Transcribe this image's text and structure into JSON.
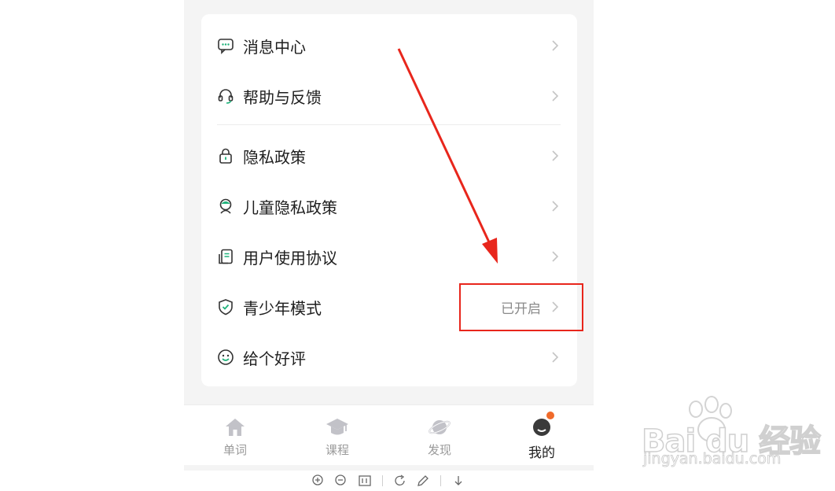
{
  "menu": {
    "items": [
      {
        "label": "消息中心",
        "icon": "message-icon"
      },
      {
        "label": "帮助与反馈",
        "icon": "headset-icon"
      },
      {
        "label": "隐私政策",
        "icon": "lock-icon"
      },
      {
        "label": "儿童隐私政策",
        "icon": "child-icon"
      },
      {
        "label": "用户使用协议",
        "icon": "document-icon"
      },
      {
        "label": "青少年模式",
        "icon": "shield-icon",
        "value": "已开启"
      },
      {
        "label": "给个好评",
        "icon": "smile-icon"
      }
    ]
  },
  "tabbar": {
    "tabs": [
      {
        "label": "单词",
        "icon": "home-icon"
      },
      {
        "label": "课程",
        "icon": "graduation-cap-icon"
      },
      {
        "label": "发现",
        "icon": "planet-icon"
      },
      {
        "label": "我的",
        "icon": "avatar-icon",
        "active": true
      }
    ]
  },
  "watermark": {
    "brand": "Bai du 经验",
    "url": "jingyan.baidu.com"
  },
  "colors": {
    "accent": "#1fb27a",
    "annotation": "#e8261c",
    "badge": "#f06a2a"
  }
}
